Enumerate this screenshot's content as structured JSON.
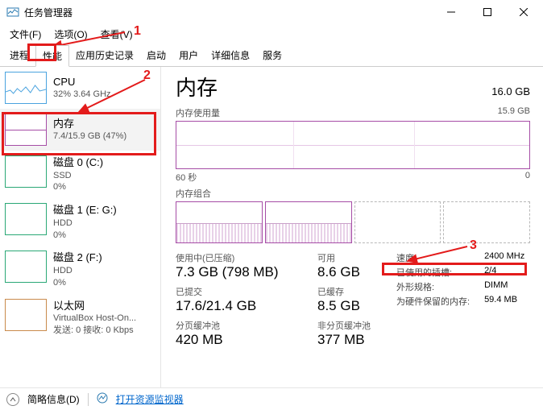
{
  "window": {
    "title": "任务管理器"
  },
  "menu": {
    "file": "文件(F)",
    "options": "选项(O)",
    "view": "查看(V)"
  },
  "tabs": {
    "proc": "进程",
    "perf": "性能",
    "hist": "应用历史记录",
    "start": "启动",
    "users": "用户",
    "detail": "详细信息",
    "serv": "服务"
  },
  "sidebar": {
    "cpu": {
      "title": "CPU",
      "sub": "32% 3.64 GHz"
    },
    "mem": {
      "title": "内存",
      "sub": "7.4/15.9 GB (47%)"
    },
    "disk0": {
      "title": "磁盘 0 (C:)",
      "sub": "SSD",
      "sub2": "0%"
    },
    "disk1": {
      "title": "磁盘 1 (E: G:)",
      "sub": "HDD",
      "sub2": "0%"
    },
    "disk2": {
      "title": "磁盘 2 (F:)",
      "sub": "HDD",
      "sub2": "0%"
    },
    "eth": {
      "title": "以太网",
      "sub": "VirtualBox Host-On...",
      "sub2": "发送: 0 接收: 0 Kbps"
    }
  },
  "main": {
    "title": "内存",
    "total": "16.0 GB",
    "usage_label": "内存使用量",
    "usage_max": "15.9 GB",
    "axis_left": "60 秒",
    "axis_right": "0",
    "comp_label": "内存组合",
    "used_label": "使用中(已压缩)",
    "used_value": "7.3 GB (798 MB)",
    "avail_label": "可用",
    "avail_value": "8.6 GB",
    "commit_label": "已提交",
    "commit_value": "17.6/21.4 GB",
    "cached_label": "已缓存",
    "cached_value": "8.5 GB",
    "paged_label": "分页缓冲池",
    "paged_value": "420 MB",
    "nonpaged_label": "非分页缓冲池",
    "nonpaged_value": "377 MB",
    "kv": {
      "speed_k": "速度:",
      "speed_v": "2400 MHz",
      "slots_k": "已使用的插槽:",
      "slots_v": "2/4",
      "form_k": "外形规格:",
      "form_v": "DIMM",
      "hw_k": "为硬件保留的内存:",
      "hw_v": "59.4 MB"
    }
  },
  "status": {
    "fewer": "简略信息(D)",
    "resmon": "打开资源监视器"
  },
  "callouts": {
    "c1": "1",
    "c2": "2",
    "c3": "3"
  }
}
